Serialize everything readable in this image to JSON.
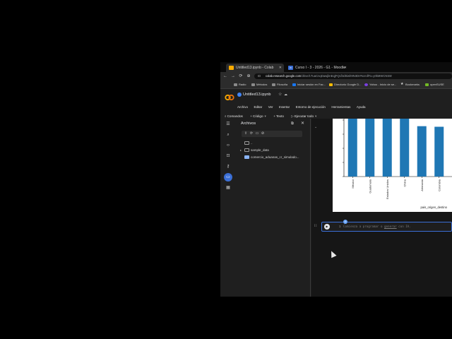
{
  "tabs": [
    {
      "label": "Untitled13.ipynb - Colab",
      "active": true
    },
    {
      "label": "Curso I - 3 - 2026 - G1 - Moodle",
      "favicon_text": "W",
      "active": false
    }
  ],
  "toolbar": {
    "back": "←",
    "forward": "→",
    "reload": "⟳",
    "info": "⊕",
    "url_host": "colab.research.google.com",
    "url_path": "/drive/1TuaCnqDawjbnEqjFQ1f3d0iwh9N3Dr#scrollTo=y0kMWCNS8r"
  },
  "bookmarks": [
    "Radio",
    "Métodos",
    "Filosofía",
    "Iniciar sesión en Fac...",
    "Directorio Google D...",
    "Yahoo - Inicio de se...",
    "Bookmarks",
    "openSUSE"
  ],
  "colab": {
    "notebook_title": "Untitled13.ipynb",
    "menus": [
      "Archivo",
      "Editar",
      "Ver",
      "Insertar",
      "Entorno de ejecución",
      "Herramientas",
      "Ayuda"
    ],
    "commands": [
      {
        "icon": "⌕",
        "label": "Comandos"
      },
      {
        "icon": "+",
        "label": "Código",
        "dropdown": true
      },
      {
        "icon": "+",
        "label": "Texto"
      },
      {
        "icon": "▷",
        "label": "Ejecutar todo",
        "dropdown": true
      }
    ]
  },
  "files_panel": {
    "title": "Archivos",
    "rows": [
      {
        "type": "folder",
        "label": ".."
      },
      {
        "type": "folder",
        "label": "sample_data",
        "expandable": true
      },
      {
        "type": "csv",
        "label": "comercio_aduanas_cr_simulado..."
      }
    ]
  },
  "cell": {
    "line_number": "1",
    "placeholder_start": "Comienza a programar o ",
    "placeholder_link": "generar",
    "placeholder_end": " con IA."
  },
  "chart_data": {
    "type": "bar",
    "xlabel": "pais_origen_destino",
    "categories": [
      "México",
      "Guatemala",
      "Estados Unidos",
      "China",
      "Alemania",
      "Colombia"
    ],
    "values": [
      1.0,
      1.0,
      1.0,
      1.0,
      0.87,
      0.86
    ],
    "bar_color": "#1f77b4"
  }
}
